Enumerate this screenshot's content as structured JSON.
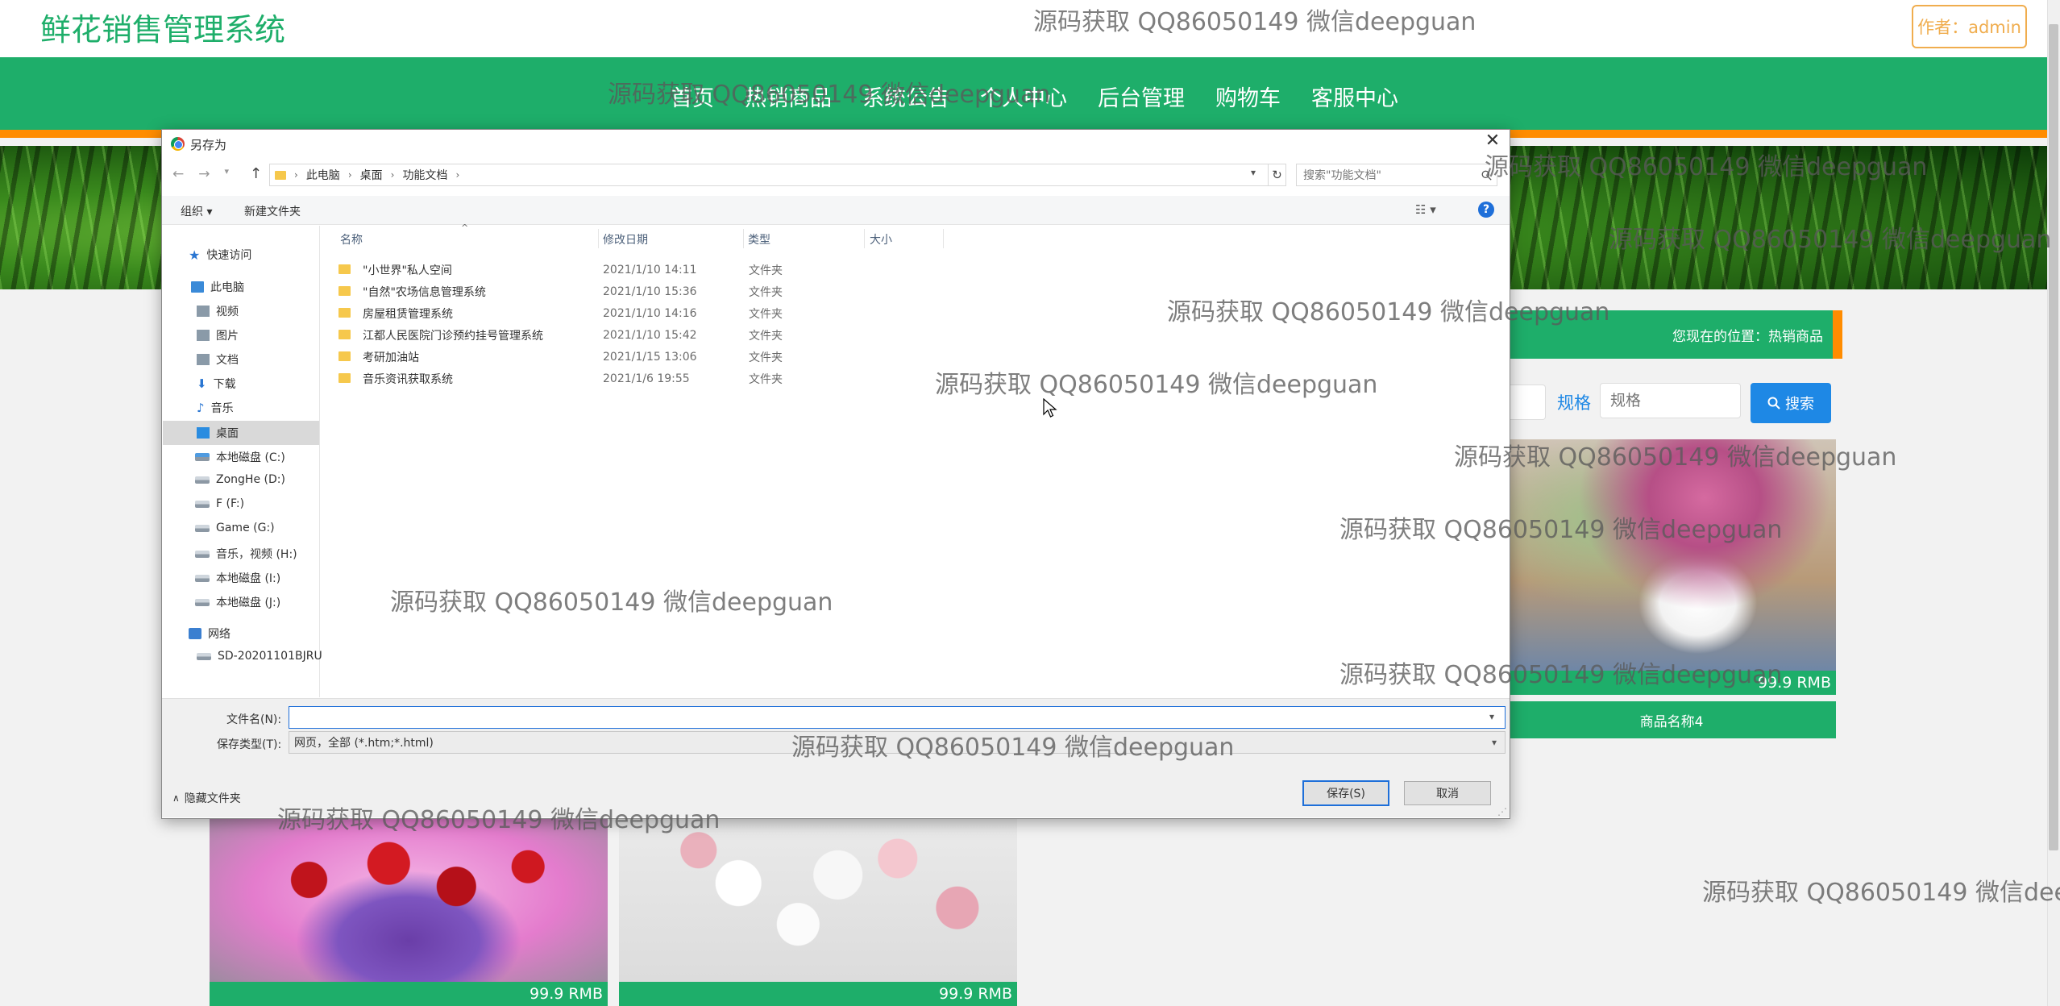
{
  "site": {
    "title": "鲜花销售管理系统",
    "author_button": "作者：admin",
    "nav": [
      "首页",
      "热销商品",
      "系统公告",
      "个人中心",
      "后台管理",
      "购物车",
      "客服中心"
    ],
    "location": "您现在的位置：热销商品",
    "spec_label": "规格",
    "spec_placeholder": "规格",
    "search_button": "搜索",
    "product_name": "商品名称4",
    "prices": [
      "99.9 RMB",
      "99.9 RMB",
      "99.9 RMB"
    ]
  },
  "dialog": {
    "title": "另存为",
    "path": [
      "此电脑",
      "桌面",
      "功能文档"
    ],
    "search_placeholder": "搜索\"功能文档\"",
    "toolbar": {
      "organize": "组织 ▾",
      "new_folder": "新建文件夹"
    },
    "nav_pane": [
      "快速访问",
      "此电脑",
      "视频",
      "图片",
      "文档",
      "下载",
      "音乐",
      "桌面",
      "本地磁盘 (C:)",
      "ZongHe (D:)",
      "F (F:)",
      "Game (G:)",
      "音乐，视频 (H:)",
      "本地磁盘 (I:)",
      "本地磁盘 (J:)",
      "网络",
      "SD-20201101BJRU"
    ],
    "columns": [
      "名称",
      "修改日期",
      "类型",
      "大小"
    ],
    "files": [
      {
        "name": "\"小世界\"私人空间",
        "date": "2021/1/10 14:11",
        "type": "文件夹"
      },
      {
        "name": "\"自然\"农场信息管理系统",
        "date": "2021/1/10 15:36",
        "type": "文件夹"
      },
      {
        "name": "房屋租赁管理系统",
        "date": "2021/1/10 14:16",
        "type": "文件夹"
      },
      {
        "name": "江都人民医院门诊预约挂号管理系统",
        "date": "2021/1/10 15:42",
        "type": "文件夹"
      },
      {
        "name": "考研加油站",
        "date": "2021/1/15 13:06",
        "type": "文件夹"
      },
      {
        "name": "音乐资讯获取系统",
        "date": "2021/1/6 19:55",
        "type": "文件夹"
      }
    ],
    "filename_label": "文件名(N):",
    "filename_value": "",
    "filetype_label": "保存类型(T):",
    "filetype_value": "网页，全部 (*.htm;*.html)",
    "hide_folders": "隐藏文件夹",
    "save_button": "保存(S)",
    "cancel_button": "取消"
  },
  "watermark": "源码获取 QQ86050149 微信deepguan"
}
